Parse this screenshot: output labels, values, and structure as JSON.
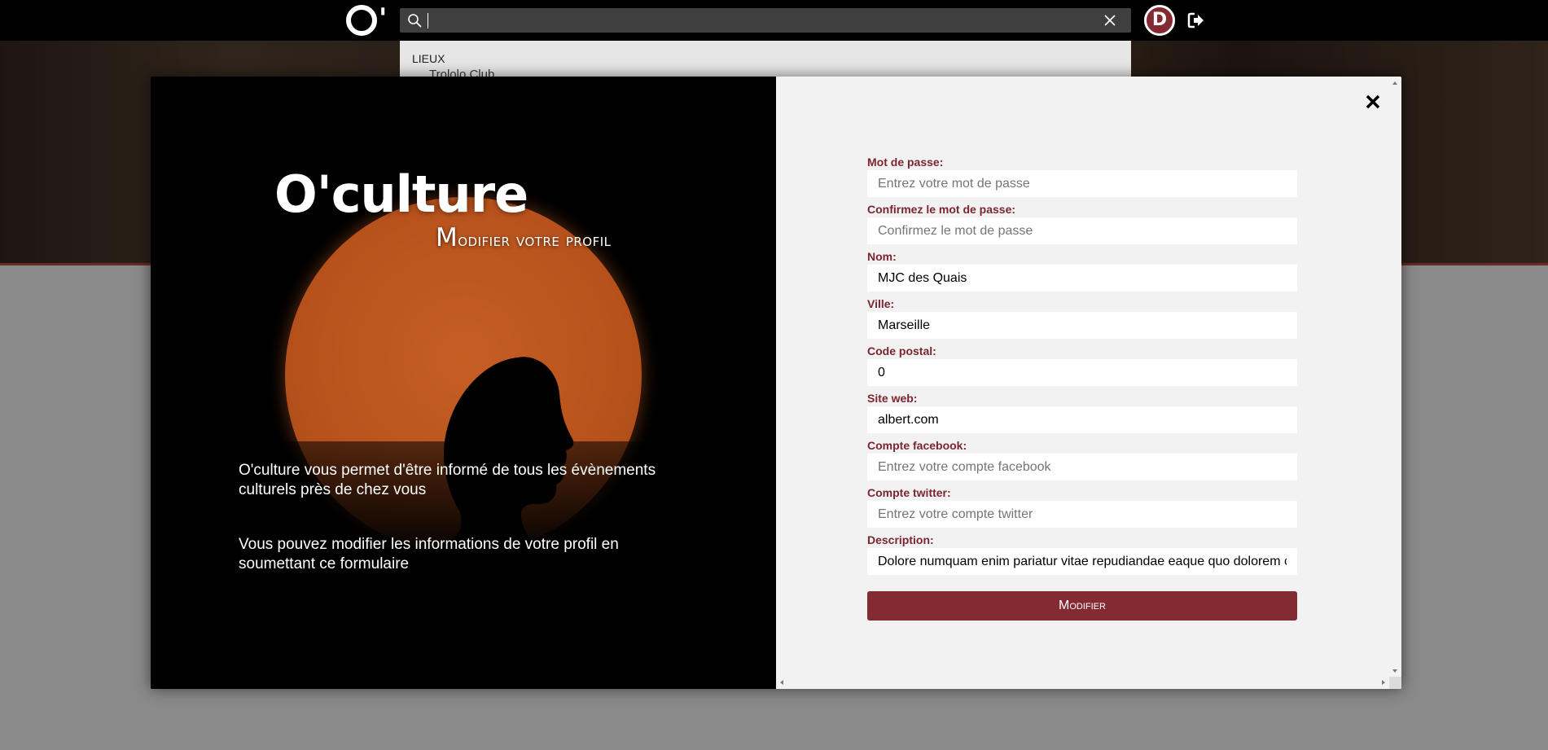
{
  "header": {
    "logo_letter": "O",
    "logo_apostrophe": "'",
    "search_value": "",
    "avatar_letter": "D"
  },
  "dropdown": {
    "category": "LIEUX",
    "item": "Trololo Club"
  },
  "modal": {
    "brand": "O'culture",
    "subtitle_first": "M",
    "subtitle_rest": "odifier votre profil",
    "intro": "O'culture vous permet d'être informé de tous les évènements culturels près de chez vous",
    "intro2": "Vous pouvez modifier les informations de votre profil en soumettant ce formulaire"
  },
  "form": {
    "password_label": "Mot de passe:",
    "password_placeholder": "Entrez votre mot de passe",
    "confirm_label": "Confirmez le mot de passe:",
    "confirm_placeholder": "Confirmez le mot de passe",
    "name_label": "Nom:",
    "name_value": "MJC des Quais",
    "city_label": "Ville:",
    "city_value": "Marseille",
    "zip_label": "Code postal:",
    "zip_value": "0",
    "web_label": "Site web:",
    "web_value": "albert.com",
    "facebook_label": "Compte facebook:",
    "facebook_placeholder": "Entrez votre compte facebook",
    "twitter_label": "Compte twitter:",
    "twitter_placeholder": "Entrez votre compte twitter",
    "description_label": "Description:",
    "description_value": "Dolore numquam enim pariatur vitae repudiandae eaque quo dolorem commodi",
    "submit_label": "Modifier"
  },
  "colors": {
    "accent": "#842a32",
    "label": "#7b2530",
    "sun": "#b8521c"
  },
  "icons": {
    "search": "search-icon",
    "clear": "close-icon",
    "logout": "logout-icon",
    "modal_close": "close-icon"
  }
}
